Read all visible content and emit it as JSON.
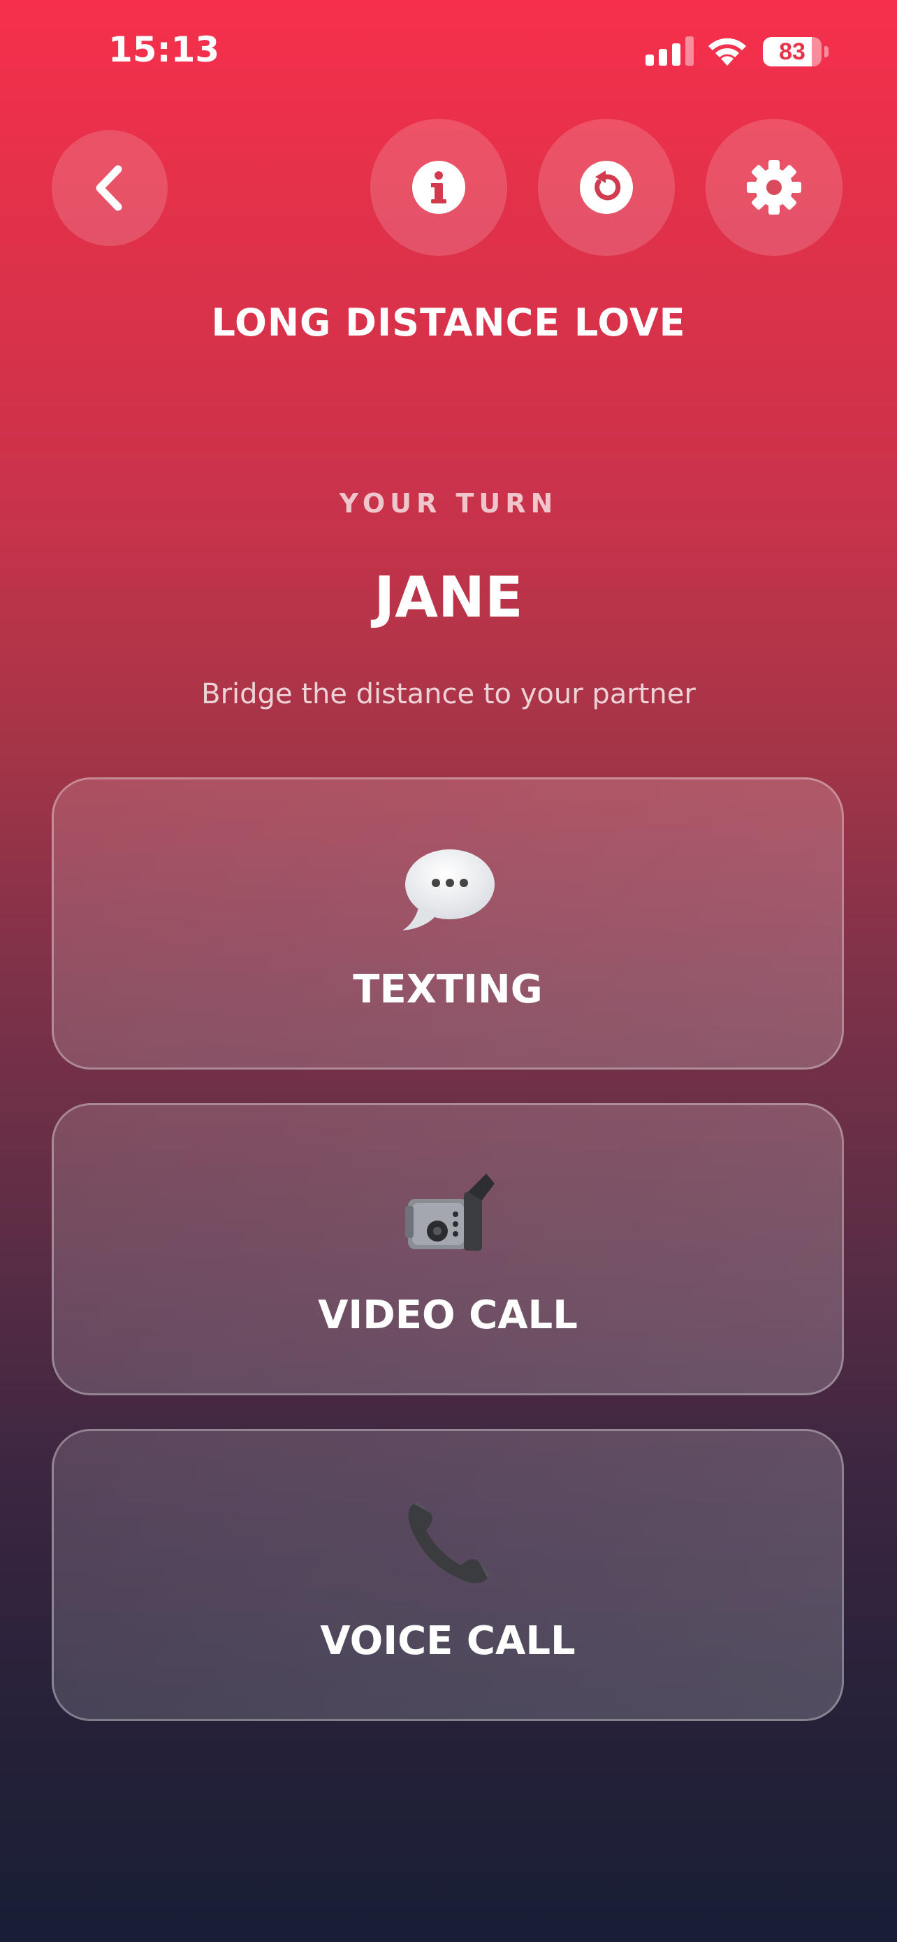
{
  "status_bar": {
    "time": "15:13",
    "battery": "83",
    "icons": [
      "signal-icon",
      "wifi-icon",
      "battery-icon"
    ]
  },
  "toolbar": {
    "icons": [
      "chevron-left-icon",
      "info-icon",
      "restart-icon",
      "gear-icon"
    ]
  },
  "header": {
    "title": "LONG DISTANCE LOVE"
  },
  "turn": {
    "label": "YOUR TURN",
    "player": "JANE",
    "subtitle": "Bridge the distance to your partner"
  },
  "options": [
    {
      "label": "TEXTING",
      "icon": "speech-bubble-icon"
    },
    {
      "label": "VIDEO CALL",
      "icon": "video-camera-icon"
    },
    {
      "label": "VOICE CALL",
      "icon": "telephone-receiver-icon"
    }
  ],
  "colors": {
    "gradient_top": "#f6304c",
    "gradient_bottom": "#171e35",
    "text": "#ffffff"
  }
}
